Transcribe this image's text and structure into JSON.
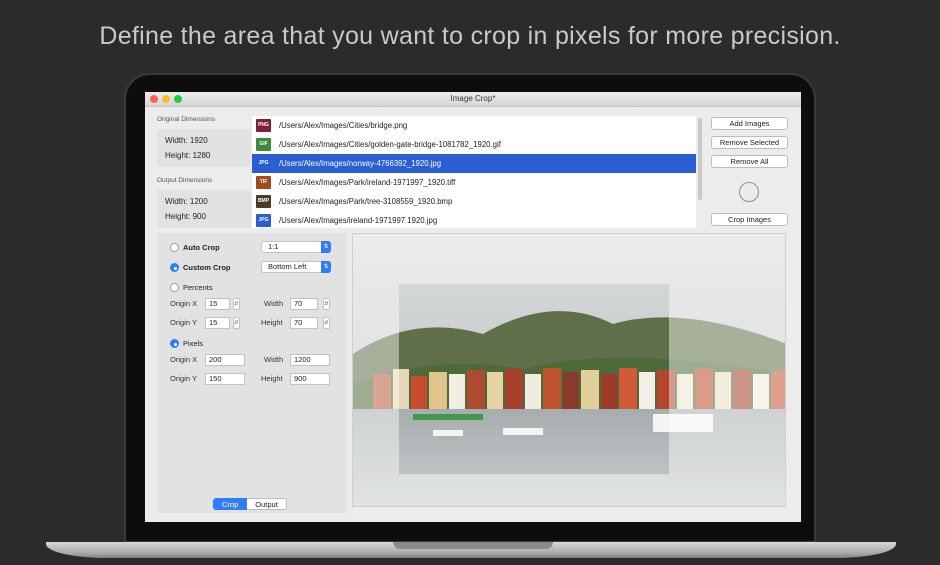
{
  "headline": "Define the area that you want to crop in pixels for more precision.",
  "window": {
    "title": "Image Crop*"
  },
  "dimensions": {
    "original_header": "Original Dimensions",
    "original_width": "Width: 1920",
    "original_height": "Height: 1280",
    "output_header": "Output Dimensions",
    "output_width": "Width: 1200",
    "output_height": "Height: 900"
  },
  "files": [
    {
      "type": "PNG",
      "color": "#7a2236",
      "path": "/Users/Alex/Images/Cities/bridge.png"
    },
    {
      "type": "GIF",
      "color": "#3d8a3a",
      "path": "/Users/Alex/Images/Cities/golden-gate-bridge-1081782_1920.gif"
    },
    {
      "type": "JPG",
      "color": "#2a5fd3",
      "path": "/Users/Alex/Images/norway-4766392_1920.jpg",
      "selected": true
    },
    {
      "type": "TIF",
      "color": "#a24a1f",
      "path": "/Users/Alex/Images/Park/ireland-1971997_1920.tiff"
    },
    {
      "type": "BMP",
      "color": "#4a3a2a",
      "path": "/Users/Alex/Images/Park/tree-3108559_1920.bmp"
    },
    {
      "type": "JPG",
      "color": "#2a5fd3",
      "path": "/Users/Alex/Images/ireland-1971997 1920.jpg"
    }
  ],
  "buttons": {
    "add_images": "Add Images",
    "remove_selected": "Remove Selected",
    "remove_all": "Remove All",
    "crop_images": "Crop Images"
  },
  "controls": {
    "auto_crop": "Auto Crop",
    "ratio_value": "1:1",
    "custom_crop": "Custom Crop",
    "anchor_value": "Bottom Left",
    "percents": "Percents",
    "origin_x_label": "Origin X",
    "origin_y_label": "Origin Y",
    "width_label": "Width",
    "height_label": "Height",
    "pct_origin_x": "15",
    "pct_origin_y": "15",
    "pct_width": "70",
    "pct_height": "70",
    "pixels": "Pixels",
    "px_origin_x": "200",
    "px_origin_y": "150",
    "px_width": "1200",
    "px_height": "900"
  },
  "tabs": {
    "crop": "Crop",
    "output": "Output"
  },
  "colors": {
    "accent": "#2f7cf6",
    "selection": "#2a5fd3"
  }
}
